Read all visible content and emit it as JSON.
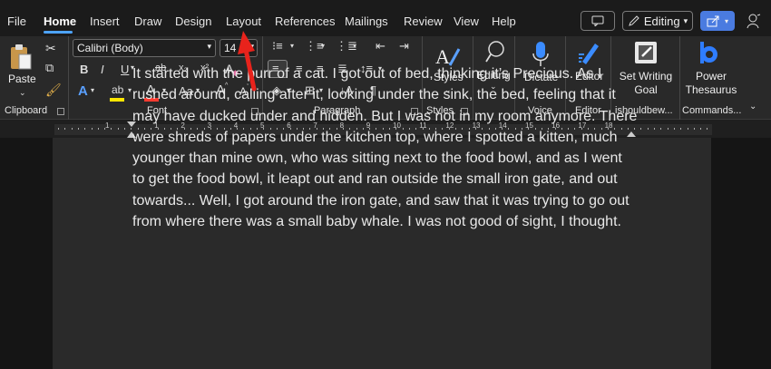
{
  "menu_tabs": [
    {
      "label": "File"
    },
    {
      "label": "Home"
    },
    {
      "label": "Insert"
    },
    {
      "label": "Draw"
    },
    {
      "label": "Design"
    },
    {
      "label": "Layout"
    },
    {
      "label": "References"
    },
    {
      "label": "Mailings"
    },
    {
      "label": "Review"
    },
    {
      "label": "View"
    },
    {
      "label": "Help"
    }
  ],
  "active_tab": "Home",
  "top_right": {
    "comments_icon": "comment-icon",
    "editing_mode": "Editing",
    "share_icon": "share-icon",
    "copilot_icon": "person-icon"
  },
  "clipboard": {
    "paste": "Paste",
    "label": "Clipboard"
  },
  "font": {
    "name": "Calibri (Body)",
    "size": "14",
    "label": "Font",
    "bold": "B",
    "italic": "I",
    "underline": "U",
    "strike": "ab",
    "subscript": "x₂",
    "superscript": "x²",
    "clear": "A",
    "effects": "A",
    "highlight": "ab",
    "color": "A",
    "case": "Aa",
    "grow": "A",
    "shrink": "A",
    "highlight_color": "#ffe600",
    "font_color": "#ff3b30"
  },
  "paragraph": {
    "label": "Paragraph",
    "pilcrow": "¶"
  },
  "styles": {
    "button": "Styles",
    "label": "Styles"
  },
  "editing_group": {
    "button": "Editing"
  },
  "voice": {
    "dictate": "Dictate",
    "label": "Voice"
  },
  "editor": {
    "button": "Editor",
    "label": "Editor"
  },
  "addins": {
    "set_goal": "Set Writing Goal",
    "addin_label": "ishouldbew...",
    "power_thesaurus": "Power Thesaurus",
    "commands_label": "Commands..."
  },
  "ruler_numbers": [
    "1",
    "1",
    "2",
    "3",
    "4",
    "5",
    "6",
    "7",
    "8",
    "9",
    "10",
    "11",
    "12",
    "13",
    "14",
    "15",
    "16",
    "17",
    "18"
  ],
  "document": {
    "lines": [
      "It started with the purr of a cat. I got out of bed, thinking it’s Precious. As I",
      "rushed around, calling after it, looking under the sink, the bed, feeling that it",
      "may have ducked under and hidden. But I was not in my room anymore. There",
      "were shreds of papers under the kitchen top, where I spotted a kitten, much",
      "younger than mine own, who was sitting next to the food bowl, and as I went",
      "to get the food bowl, it leapt out and ran outside the small iron gate, and out",
      "towards... Well, I got around the iron gate, and saw that it was trying to go out",
      "from where there was a small baby whale. I was not good of sight, I thought."
    ]
  },
  "annotation": {
    "color": "#e8231c"
  }
}
